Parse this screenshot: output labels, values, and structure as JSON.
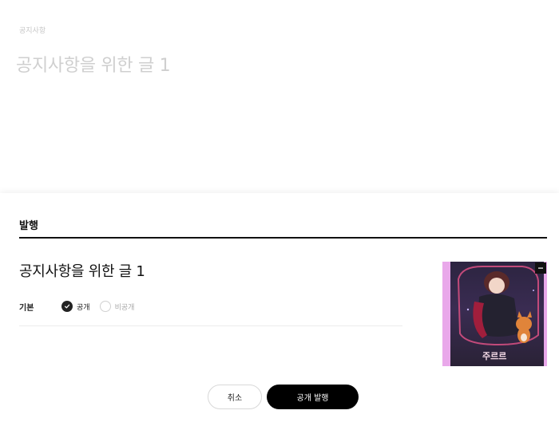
{
  "editor": {
    "category": "공지사항",
    "title": "공지사항을 위한 글 1"
  },
  "publish_panel": {
    "heading": "발행",
    "post_title": "공지사항을 위한 글 1",
    "visibility": {
      "label": "기본",
      "options": [
        {
          "label": "공개",
          "selected": true
        },
        {
          "label": "비공개",
          "selected": false
        }
      ]
    },
    "thumbnail": {
      "title_text": "주르르",
      "remove_icon": "minus-icon"
    },
    "buttons": {
      "cancel": "취소",
      "publish": "공개 발행"
    }
  },
  "colors": {
    "primary": "#000000",
    "thumbnail_border": "#e9a8ea"
  }
}
